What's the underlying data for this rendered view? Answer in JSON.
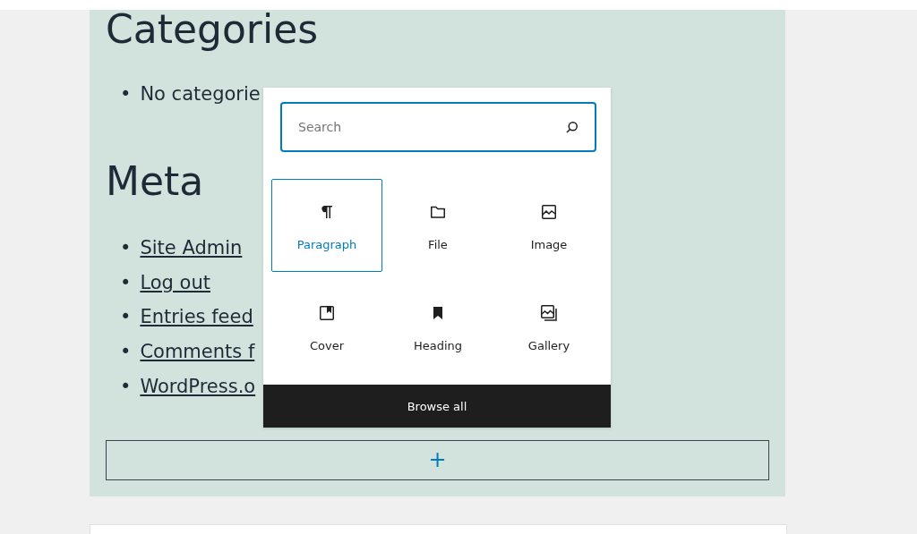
{
  "widgets": [
    {
      "heading": "Categories",
      "items": [
        {
          "kind": "text",
          "bullet": "•",
          "label": "No categorie"
        }
      ]
    },
    {
      "heading": "Meta",
      "items": [
        {
          "kind": "link",
          "bullet": "•",
          "label": "Site Admin"
        },
        {
          "kind": "link",
          "bullet": "•",
          "label": "Log out"
        },
        {
          "kind": "link",
          "bullet": "•",
          "label": "Entries feed"
        },
        {
          "kind": "link",
          "bullet": "•",
          "label": "Comments f"
        },
        {
          "kind": "link",
          "bullet": "•",
          "label": "WordPress.o"
        }
      ]
    }
  ],
  "add_block_button": {
    "label": "+"
  },
  "inserter": {
    "search": {
      "placeholder": "Search"
    },
    "blocks": [
      {
        "label": "Paragraph",
        "selected": true
      },
      {
        "label": "File",
        "selected": false
      },
      {
        "label": "Image",
        "selected": false
      },
      {
        "label": "Cover",
        "selected": false
      },
      {
        "label": "Heading",
        "selected": false
      },
      {
        "label": "Gallery",
        "selected": false
      }
    ],
    "browse_all": "Browse all"
  }
}
